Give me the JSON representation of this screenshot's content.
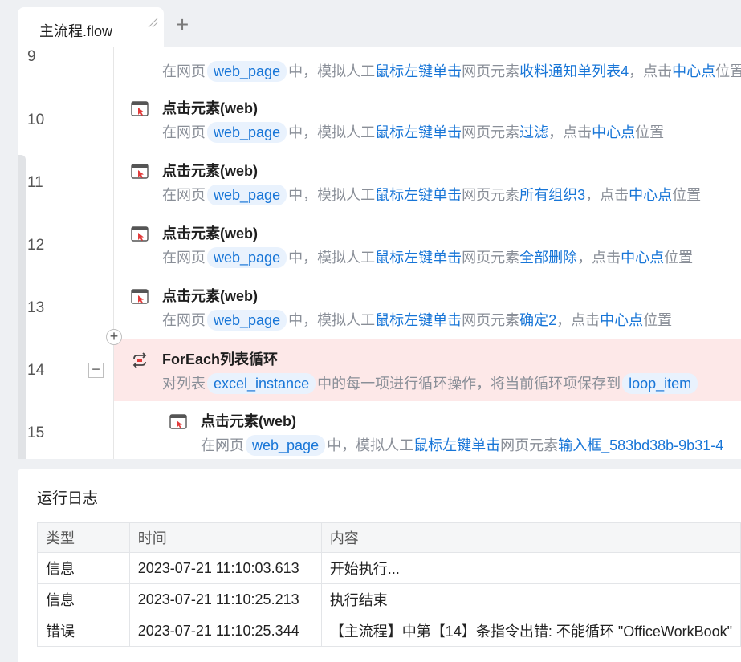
{
  "tabs": [
    {
      "label": "主流程.flow"
    }
  ],
  "editor": {
    "rows": [
      {
        "line": "9",
        "title": "",
        "desc": [
          [
            "在网页",
            ""
          ],
          [
            "web_page",
            "chip"
          ],
          [
            "中，模拟人工",
            ""
          ],
          [
            "鼠标左键单击",
            "hl"
          ],
          [
            "网页元素",
            ""
          ],
          [
            "收料通知单列表4",
            "hl"
          ],
          [
            "，点击",
            ""
          ],
          [
            "中心点",
            "hl"
          ],
          [
            "位置",
            ""
          ]
        ]
      },
      {
        "line": "10",
        "title": "点击元素(web)",
        "desc": [
          [
            "在网页",
            ""
          ],
          [
            "web_page",
            "chip"
          ],
          [
            "中，模拟人工",
            ""
          ],
          [
            "鼠标左键单击",
            "hl"
          ],
          [
            "网页元素",
            ""
          ],
          [
            "过滤",
            "hl"
          ],
          [
            "，点击",
            ""
          ],
          [
            "中心点",
            "hl"
          ],
          [
            "位置",
            ""
          ]
        ]
      },
      {
        "line": "11",
        "title": "点击元素(web)",
        "desc": [
          [
            "在网页",
            ""
          ],
          [
            "web_page",
            "chip"
          ],
          [
            "中，模拟人工",
            ""
          ],
          [
            "鼠标左键单击",
            "hl"
          ],
          [
            "网页元素",
            ""
          ],
          [
            "所有组织3",
            "hl"
          ],
          [
            "，点击",
            ""
          ],
          [
            "中心点",
            "hl"
          ],
          [
            "位置",
            ""
          ]
        ]
      },
      {
        "line": "12",
        "title": "点击元素(web)",
        "desc": [
          [
            "在网页",
            ""
          ],
          [
            "web_page",
            "chip"
          ],
          [
            "中，模拟人工",
            ""
          ],
          [
            "鼠标左键单击",
            "hl"
          ],
          [
            "网页元素",
            ""
          ],
          [
            "全部删除",
            "hl"
          ],
          [
            "，点击",
            ""
          ],
          [
            "中心点",
            "hl"
          ],
          [
            "位置",
            ""
          ]
        ]
      },
      {
        "line": "13",
        "title": "点击元素(web)",
        "desc": [
          [
            "在网页",
            ""
          ],
          [
            "web_page",
            "chip"
          ],
          [
            "中，模拟人工",
            ""
          ],
          [
            "鼠标左键单击",
            "hl"
          ],
          [
            "网页元素",
            ""
          ],
          [
            "确定2",
            "hl"
          ],
          [
            "，点击",
            ""
          ],
          [
            "中心点",
            "hl"
          ],
          [
            "位置",
            ""
          ]
        ]
      },
      {
        "line": "14",
        "title": "ForEach列表循环",
        "desc": [
          [
            "对列表",
            ""
          ],
          [
            "excel_instance",
            "chip"
          ],
          [
            "中的每一项进行循环操作，将当前循环项保存到",
            ""
          ],
          [
            "loop_item",
            "chip"
          ]
        ]
      },
      {
        "line": "15",
        "title": "点击元素(web)",
        "desc": [
          [
            "在网页",
            ""
          ],
          [
            "web_page",
            "chip"
          ],
          [
            "中，模拟人工",
            ""
          ],
          [
            "鼠标左键单击",
            "hl"
          ],
          [
            "网页元素",
            ""
          ],
          [
            "输入框_583bd38b-9b31-4",
            "hl"
          ]
        ]
      }
    ]
  },
  "log": {
    "title": "运行日志",
    "columns": [
      "类型",
      "时间",
      "内容"
    ],
    "rows": [
      [
        "信息",
        "2023-07-21 11:10:03.613",
        "开始执行..."
      ],
      [
        "信息",
        "2023-07-21 11:10:25.213",
        "执行结束"
      ],
      [
        "错误",
        "2023-07-21 11:10:25.344",
        "【主流程】中第【14】条指令出错: 不能循环 \"OfficeWorkBook\""
      ]
    ]
  },
  "colors": {
    "accent": "#1775d7",
    "chip_bg": "#e9f2fd",
    "error_row_bg": "#fde8e8",
    "muted_text": "#8a8f98"
  }
}
